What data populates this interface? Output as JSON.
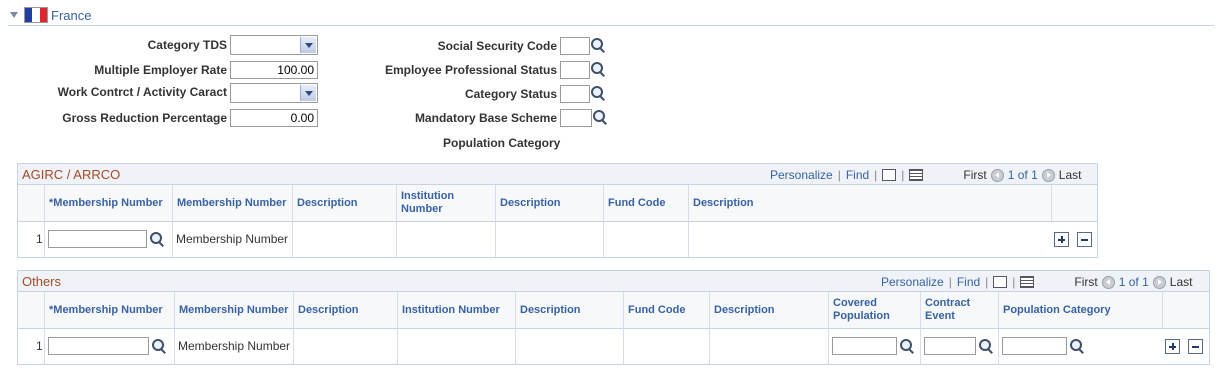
{
  "section": {
    "title": "France"
  },
  "form": {
    "left": [
      {
        "label": "Category TDS",
        "type": "select",
        "value": ""
      },
      {
        "label": "Multiple Employer Rate",
        "type": "text",
        "value": "100.00"
      },
      {
        "label": "Work Contrct / Activity Caract",
        "type": "select",
        "value": ""
      },
      {
        "label": "Gross Reduction Percentage",
        "type": "text",
        "value": "0.00"
      }
    ],
    "right": [
      {
        "label": "Social Security Code",
        "value": ""
      },
      {
        "label": "Employee Professional Status",
        "value": ""
      },
      {
        "label": "Category Status",
        "value": ""
      },
      {
        "label": "Mandatory Base Scheme",
        "value": ""
      }
    ],
    "population_category_label": "Population Category"
  },
  "grid_nav": {
    "personalize": "Personalize",
    "find": "Find",
    "first": "First",
    "count": "1 of 1",
    "last": "Last"
  },
  "agirc": {
    "title": "AGIRC / ARRCO",
    "columns": [
      "*Membership Number",
      "Membership Number",
      "Description",
      "Institution Number",
      "Description",
      "Fund Code",
      "Description"
    ],
    "row": {
      "num": "1",
      "membership_value": "",
      "membership_text": "Membership Number"
    }
  },
  "others": {
    "title": "Others",
    "columns": [
      "*Membership Number",
      "Membership Number",
      "Description",
      "Institution Number",
      "Description",
      "Fund Code",
      "Description",
      "Covered Population",
      "Contract Event",
      "Population Category"
    ],
    "row": {
      "num": "1",
      "membership_value": "",
      "membership_text": "Membership Number",
      "covered_value": "",
      "contract_value": "",
      "population_value": ""
    }
  }
}
